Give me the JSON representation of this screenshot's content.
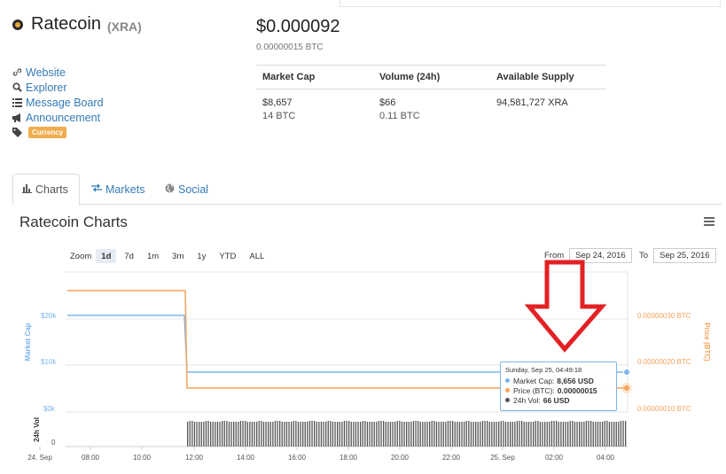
{
  "coin": {
    "name": "Ratecoin",
    "symbol": "(XRA)"
  },
  "links": [
    {
      "label": "Website",
      "icon": "link-icon"
    },
    {
      "label": "Explorer",
      "icon": "search-icon"
    },
    {
      "label": "Message Board",
      "icon": "list-icon"
    },
    {
      "label": "Announcement",
      "icon": "bullhorn-icon"
    }
  ],
  "tag": {
    "label": "Currency",
    "icon": "tag-icon"
  },
  "price": {
    "usd": "$0.000092",
    "btc": "0.00000015 BTC"
  },
  "stats": {
    "headers": [
      "Market Cap",
      "Volume (24h)",
      "Available Supply"
    ],
    "market_cap": [
      "$8,657",
      "14 BTC"
    ],
    "volume": [
      "$66",
      "0.11 BTC"
    ],
    "supply": "94,581,727 XRA"
  },
  "tabs": [
    {
      "label": "Charts",
      "icon": "bar-chart-icon",
      "active": true
    },
    {
      "label": "Markets",
      "icon": "exchange-icon",
      "active": false
    },
    {
      "label": "Social",
      "icon": "globe-icon",
      "active": false
    }
  ],
  "charts_title": "Ratecoin Charts",
  "zoom": {
    "label": "Zoom",
    "options": [
      "1d",
      "7d",
      "1m",
      "3m",
      "1y",
      "YTD",
      "ALL"
    ],
    "selected": "1d"
  },
  "range": {
    "from_label": "From",
    "from": "Sep 24, 2016",
    "to_label": "To",
    "to": "Sep 25, 2016"
  },
  "tooltip": {
    "header": "Sunday, Sep 25, 04:49:18",
    "rows": [
      {
        "label": "Market Cap:",
        "value": "8,656 USD",
        "color": "#7cb5ec"
      },
      {
        "label": "Price (BTC):",
        "value": "0.00000015",
        "color": "#f7a35c"
      },
      {
        "label": "24h Vol:",
        "value": "66 USD",
        "color": "#555555"
      }
    ]
  },
  "chart_data": {
    "type": "line",
    "x_ticks": [
      "24. Sep",
      "08:00",
      "10:00",
      "12:00",
      "14:00",
      "16:00",
      "18:00",
      "20:00",
      "22:00",
      "25. Sep",
      "02:00",
      "04:00"
    ],
    "left_axis": {
      "label": "Market Cap",
      "ticks": [
        "$20k",
        "$10k",
        "$0k"
      ],
      "color": "#7cb5ec"
    },
    "right_axis": {
      "label": "Price (BTC)",
      "ticks": [
        "0.00000030 BTC",
        "0.00000020 BTC",
        "0.00000010 BTC"
      ],
      "color": "#f7a35c"
    },
    "volume_axis": {
      "label": "24h Vol",
      "ticks": [
        "0"
      ]
    },
    "series": [
      {
        "name": "Market Cap",
        "color": "#7cb5ec",
        "points": [
          [
            "06:00",
            20600
          ],
          [
            "11:45",
            20600
          ],
          [
            "11:55",
            8600
          ],
          [
            "04:49",
            8656
          ]
        ]
      },
      {
        "name": "Price (BTC)",
        "color": "#f7a35c",
        "points": [
          [
            "06:00",
            3.6e-07
          ],
          [
            "11:45",
            3.6e-07
          ],
          [
            "11:55",
            1.5e-07
          ],
          [
            "04:49",
            1.5e-07
          ]
        ]
      },
      {
        "name": "24h Vol",
        "color": "#555555"
      }
    ]
  },
  "annotation": {
    "type": "arrow",
    "color": "#e32124"
  }
}
